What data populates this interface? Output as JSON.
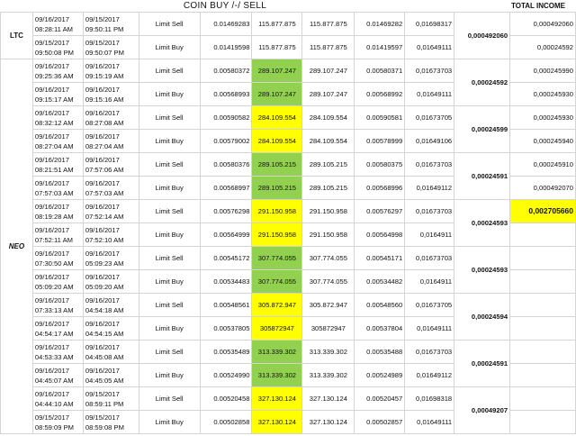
{
  "header": {
    "title": "COIN BUY /-/ SELL",
    "total_income_label": "TOTAL INCOME"
  },
  "coins": {
    "ltc": "LTC",
    "neo": "NEO"
  },
  "rows": [
    {
      "d1": "09/16/2017\n08:28:11 AM",
      "d2": "09/15/2017\n09:50:11 PM",
      "type": "Limit Sell",
      "p1": "0.01469283",
      "amt": "115.877.875",
      "amt2": "115.877.875",
      "p2": "0.01469282",
      "p3": "0,01698317",
      "hl": ""
    },
    {
      "d1": "09/15/2017\n09:50:08 PM",
      "d2": "09/15/2017\n09:50:07 PM",
      "type": "Limit Buy",
      "p1": "0.01419598",
      "amt": "115.877.875",
      "amt2": "115.877.875",
      "p2": "0.01419597",
      "p3": "0,01649111",
      "hl": ""
    },
    {
      "d1": "09/16/2017\n09:25:36 AM",
      "d2": "09/16/2017\n09:15:19 AM",
      "type": "Limit Sell",
      "p1": "0.00580372",
      "amt": "289.107.247",
      "amt2": "289.107.247",
      "p2": "0.00580371",
      "p3": "0,01673703",
      "hl": "green"
    },
    {
      "d1": "09/16/2017\n09:15:17 AM",
      "d2": "09/16/2017\n09:15:16 AM",
      "type": "Limit Buy",
      "p1": "0.00568993",
      "amt": "289.107.247",
      "amt2": "289.107.247",
      "p2": "0.00568992",
      "p3": "0,01649111",
      "hl": "green"
    },
    {
      "d1": "09/16/2017\n08:32:12 AM",
      "d2": "09/16/2017\n08:27:08 AM",
      "type": "Limit Sell",
      "p1": "0.00590582",
      "amt": "284.109.554",
      "amt2": "284.109.554",
      "p2": "0.00590581",
      "p3": "0,01673705",
      "hl": "yellow"
    },
    {
      "d1": "09/16/2017\n08:27:04 AM",
      "d2": "09/16/2017\n08:27:04 AM",
      "type": "Limit Buy",
      "p1": "0.00579002",
      "amt": "284.109.554",
      "amt2": "284.109.554",
      "p2": "0.00578999",
      "p3": "0,01649106",
      "hl": "yellow"
    },
    {
      "d1": "09/16/2017\n08:21:51 AM",
      "d2": "09/16/2017\n07:57:06 AM",
      "type": "Limit Sell",
      "p1": "0.00580376",
      "amt": "289.105.215",
      "amt2": "289.105.215",
      "p2": "0.00580375",
      "p3": "0,01673703",
      "hl": "green"
    },
    {
      "d1": "09/16/2017\n07:57:03 AM",
      "d2": "09/16/2017\n07:57:03 AM",
      "type": "Limit Buy",
      "p1": "0.00568997",
      "amt": "289.105.215",
      "amt2": "289.105.215",
      "p2": "0.00568996",
      "p3": "0,01649112",
      "hl": "green"
    },
    {
      "d1": "09/16/2017\n08:19:28 AM",
      "d2": "09/16/2017\n07:52:14 AM",
      "type": "Limit Sell",
      "p1": "0.00576298",
      "amt": "291.150.958",
      "amt2": "291.150.958",
      "p2": "0.00576297",
      "p3": "0,01673703",
      "hl": "yellow"
    },
    {
      "d1": "09/16/2017\n07:52:11 AM",
      "d2": "09/16/2017\n07:52:10 AM",
      "type": "Limit Buy",
      "p1": "0.00564999",
      "amt": "291.150.958",
      "amt2": "291.150.958",
      "p2": "0.00564998",
      "p3": "0,0164911",
      "hl": "yellow"
    },
    {
      "d1": "09/16/2017\n07:30:50 AM",
      "d2": "09/16/2017\n05:09:23 AM",
      "type": "Limit Sell",
      "p1": "0.00545172",
      "amt": "307.774.055",
      "amt2": "307.774.055",
      "p2": "0.00545171",
      "p3": "0,01673703",
      "hl": "green"
    },
    {
      "d1": "09/16/2017\n05:09:20 AM",
      "d2": "09/16/2017\n05:09:20 AM",
      "type": "Limit Buy",
      "p1": "0.00534483",
      "amt": "307.774.055",
      "amt2": "307.774.055",
      "p2": "0.00534482",
      "p3": "0,0164911",
      "hl": "green"
    },
    {
      "d1": "09/16/2017\n07:33:13 AM",
      "d2": "09/16/2017\n04:54:18 AM",
      "type": "Limit Sell",
      "p1": "0.00548561",
      "amt": "305.872.947",
      "amt2": "305.872.947",
      "p2": "0.00548560",
      "p3": "0,01673705",
      "hl": "yellow"
    },
    {
      "d1": "09/16/2017\n04:54:17 AM",
      "d2": "09/16/2017\n04:54:15 AM",
      "type": "Limit Buy",
      "p1": "0.00537805",
      "amt": "305872947",
      "amt2": "305872947",
      "p2": "0.00537804",
      "p3": "0,01649111",
      "hl": "yellow"
    },
    {
      "d1": "09/16/2017\n04:53:33 AM",
      "d2": "09/16/2017\n04:45:08 AM",
      "type": "Limit Sell",
      "p1": "0.00535489",
      "amt": "313.339.302",
      "amt2": "313.339.302",
      "p2": "0.00535488",
      "p3": "0,01673703",
      "hl": "green"
    },
    {
      "d1": "09/16/2017\n04:45:07 AM",
      "d2": "09/16/2017\n04:45:05 AM",
      "type": "Limit Buy",
      "p1": "0.00524990",
      "amt": "313.339.302",
      "amt2": "313.339.302",
      "p2": "0.00524989",
      "p3": "0,01649112",
      "hl": "green"
    },
    {
      "d1": "09/16/2017\n04:44:10 AM",
      "d2": "09/15/2017\n08:59:11 PM",
      "type": "Limit Sell",
      "p1": "0.00520458",
      "amt": "327.130.124",
      "amt2": "327.130.124",
      "p2": "0.00520457",
      "p3": "0,01698318",
      "hl": "yellow"
    },
    {
      "d1": "09/15/2017\n08:59:09 PM",
      "d2": "09/15/2017\n08:59:08 PM",
      "type": "Limit Buy",
      "p1": "0.00502858",
      "amt": "327.130.124",
      "amt2": "327.130.124",
      "p2": "0.00502857",
      "p3": "0,01649111",
      "hl": "yellow"
    }
  ],
  "pair_profits": [
    "0,000492060",
    "0,00024592",
    "0,00024599",
    "0,00024591",
    "0,00024593",
    "0,00024593",
    "0,00024594",
    "0,00024591",
    "0,00049207"
  ],
  "income": [
    "0,000492060",
    "0,00024592",
    "0,000245990",
    "0,000245930",
    "0,000245930",
    "0,000245940",
    "0,000245910",
    "0,000492070",
    "0,002705660",
    "",
    "",
    "",
    "",
    "",
    "",
    "",
    "",
    ""
  ],
  "income_highlight_index": 8
}
